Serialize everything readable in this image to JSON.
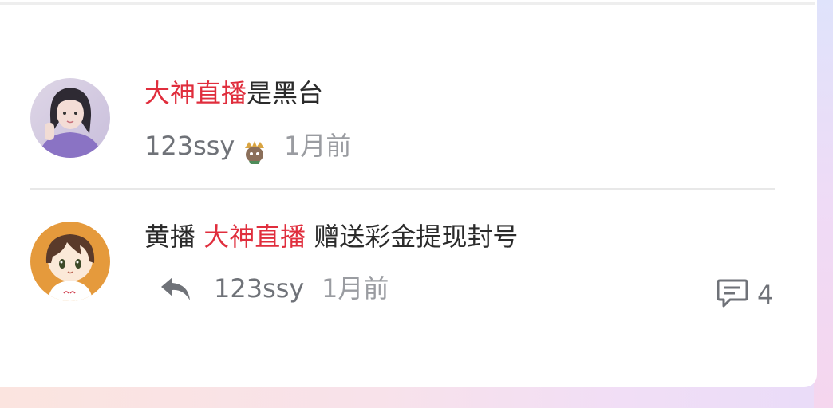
{
  "comments": [
    {
      "keyword": "大神直播",
      "rest": "是黑台",
      "username": "123ssy",
      "time": "1月前"
    },
    {
      "prefix": "黄播 ",
      "keyword": "大神直播",
      "rest": " 赠送彩金提现封号",
      "username": "123ssy",
      "time": "1月前",
      "reply_count": "4"
    }
  ],
  "colors": {
    "keyword_highlight": "#e02e3d",
    "text": "#2b2b2b",
    "meta": "#6f7278"
  },
  "icons": [
    "badge-icon",
    "reply-arrow-icon",
    "comment-bubble-icon"
  ]
}
